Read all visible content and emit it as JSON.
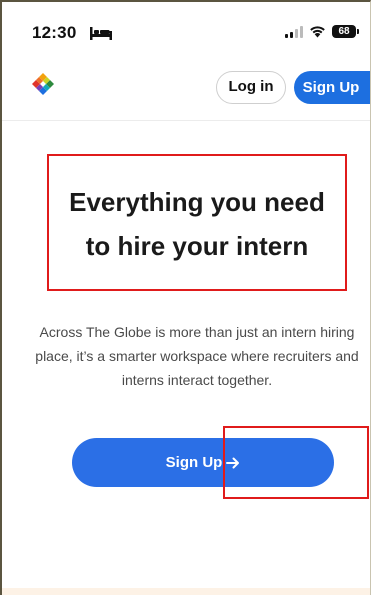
{
  "status_bar": {
    "time": "12:30",
    "battery": "68",
    "icons": [
      "bed-icon",
      "signal-icon",
      "wifi-icon",
      "battery-icon"
    ]
  },
  "nav": {
    "logo_icon": "colorful-flower-logo-icon",
    "login_label": "Log in",
    "signup_label": "Sign Up"
  },
  "hero": {
    "title_line1": "Everything you need",
    "title_line2": "to hire your intern",
    "description": "Across The Globe is more than just an intern hiring place, it’s a smarter workspace where recruiters and interns interact together.",
    "cta_label": "Sign Up",
    "cta_icon": "arrow-right-icon"
  },
  "colors": {
    "primary": "#1d6fe0",
    "cta": "#2b6fe6",
    "annotation": "#e01b1b",
    "footer_band": "#fdf2e6"
  }
}
